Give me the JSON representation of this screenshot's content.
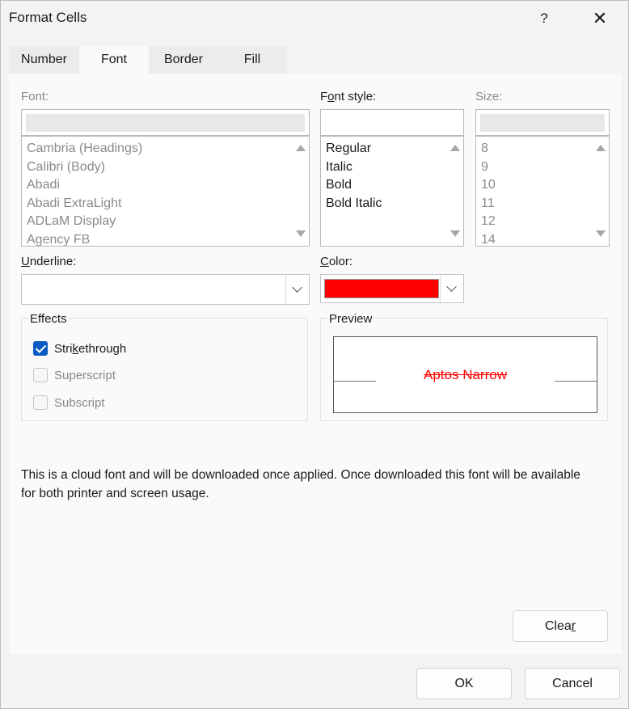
{
  "window": {
    "title": "Format Cells",
    "help_glyph": "?",
    "close_glyph": "✕"
  },
  "tabs": [
    {
      "label": "Number"
    },
    {
      "label": "Font",
      "active": true
    },
    {
      "label": "Border"
    },
    {
      "label": "Fill"
    }
  ],
  "font": {
    "label_text": "Font:",
    "input_value": "",
    "items": [
      "Cambria (Headings)",
      "Calibri (Body)",
      "Abadi",
      "Abadi ExtraLight",
      "ADLaM Display",
      "Agency FB"
    ]
  },
  "font_style": {
    "label_pre": "F",
    "label_key": "o",
    "label_post": "nt style:",
    "input_value": "",
    "items": [
      "Regular",
      "Italic",
      "Bold",
      "Bold Italic"
    ]
  },
  "size": {
    "label_text": "Size:",
    "input_value": "",
    "items": [
      "8",
      "9",
      "10",
      "11",
      "12",
      "14"
    ]
  },
  "underline": {
    "label_key": "U",
    "label_post": "nderline:",
    "value": ""
  },
  "color": {
    "label_key": "C",
    "label_post": "olor:",
    "swatch": "#ff0000"
  },
  "effects": {
    "title": "Effects",
    "strikethrough": {
      "pre": "Stri",
      "key": "k",
      "post": "ethrough",
      "checked": true
    },
    "superscript": {
      "label": "Superscript",
      "checked": false
    },
    "subscript": {
      "label": "Subscript",
      "checked": false
    }
  },
  "preview": {
    "title": "Preview",
    "sample": "Aptos Narrow",
    "color": "#ff0000"
  },
  "info_line1": "This is a cloud font and will be downloaded once applied. Once downloaded this font will be available",
  "info_line2": "for both printer and screen usage.",
  "clear": {
    "pre": "Clea",
    "key": "r"
  },
  "ok_label": "OK",
  "cancel_label": "Cancel"
}
